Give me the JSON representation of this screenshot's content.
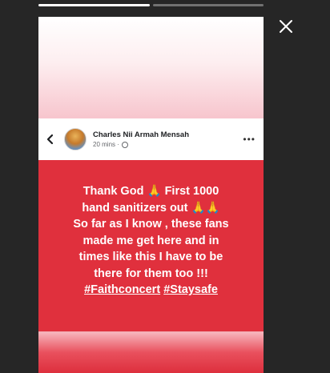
{
  "story": {
    "progress_segments": [
      1.0,
      0.0
    ],
    "close_icon": "close-icon"
  },
  "post": {
    "author": "Charles Nii Armah Mensah",
    "time": "20 mins",
    "privacy_icon": "globe-icon",
    "back_icon": "chevron-left-icon",
    "more_icon": "more-dots-icon",
    "more_label": "•••",
    "body": {
      "line1_a": "Thank God",
      "line1_emoji": "🙏",
      "line1_b": "First 1000",
      "line2_a": "hand sanitizers out",
      "line2_emoji": "🙏🙏",
      "line3": "So far as I know , these fans",
      "line4": "made me get here and in",
      "line5": "times like this I have to be",
      "line6": "there for them too !!!",
      "hashtag1": "#Faithconcert",
      "hashtag2": "#Staysafe"
    },
    "colors": {
      "post_background": "#e0303d",
      "text": "#ffffff"
    }
  }
}
